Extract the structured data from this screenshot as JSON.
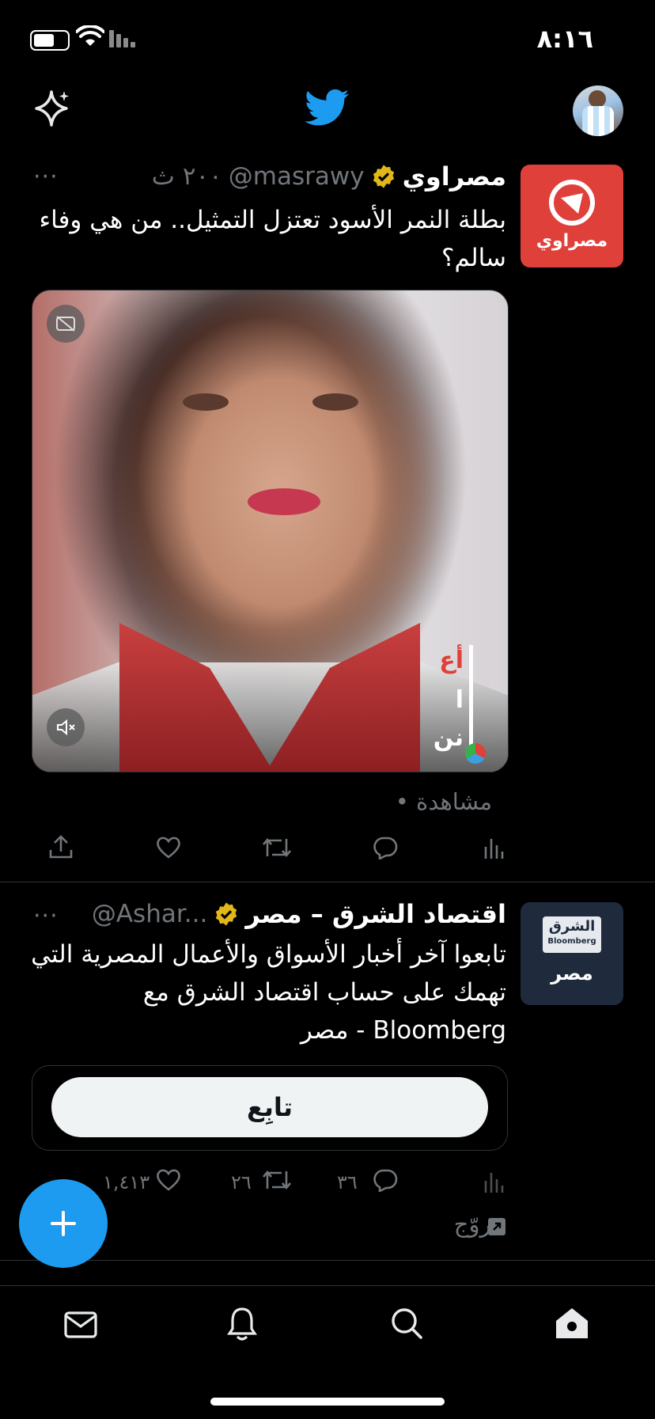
{
  "status_bar": {
    "time": "٨:١٦"
  },
  "header": {
    "title_icon": "twitter-bird-icon",
    "left_icon": "sparkle-icon",
    "avatar": "profile-avatar"
  },
  "tweets": [
    {
      "display_name": "مصراوي",
      "handle": "@masrawy",
      "time": "٢٠٠ ث",
      "avatar_label": "مصراوي",
      "text": "بطلة النمر الأسود تعتزل التمثيل.. من هي وفاء سالم؟",
      "media_overlay_lines": [
        "أع",
        "ا",
        "نن"
      ],
      "views_label": "• مشاهدة",
      "more": "···",
      "colors": {
        "avatar_bg": "#e0403a"
      }
    },
    {
      "display_name": "اقتصاد الشرق – مصر",
      "handle": "@Ashar...",
      "avatar_title": "الشرق",
      "avatar_sub": "Bloomberg",
      "avatar_region": "مصر",
      "text": "تابعوا آخر أخبار الأسواق والأعمال المصرية التي تهمك على حساب اقتصاد الشرق مع Bloomberg - مصر",
      "follow_label": "تابِع",
      "replies": "٣٦",
      "retweets": "٢٦",
      "likes": "١,٤١٣",
      "promoted_label": "مروّج",
      "more": "···",
      "colors": {
        "avatar_bg": "#1f2b3d"
      }
    }
  ],
  "fab": {
    "icon": "plus-icon"
  },
  "bottom_nav": [
    "messages-icon",
    "notifications-icon",
    "search-icon",
    "home-icon"
  ],
  "colors": {
    "accent": "#1d9bf0",
    "verified": "#e2b719",
    "muted": "#71767b",
    "divider": "#2f3336"
  }
}
